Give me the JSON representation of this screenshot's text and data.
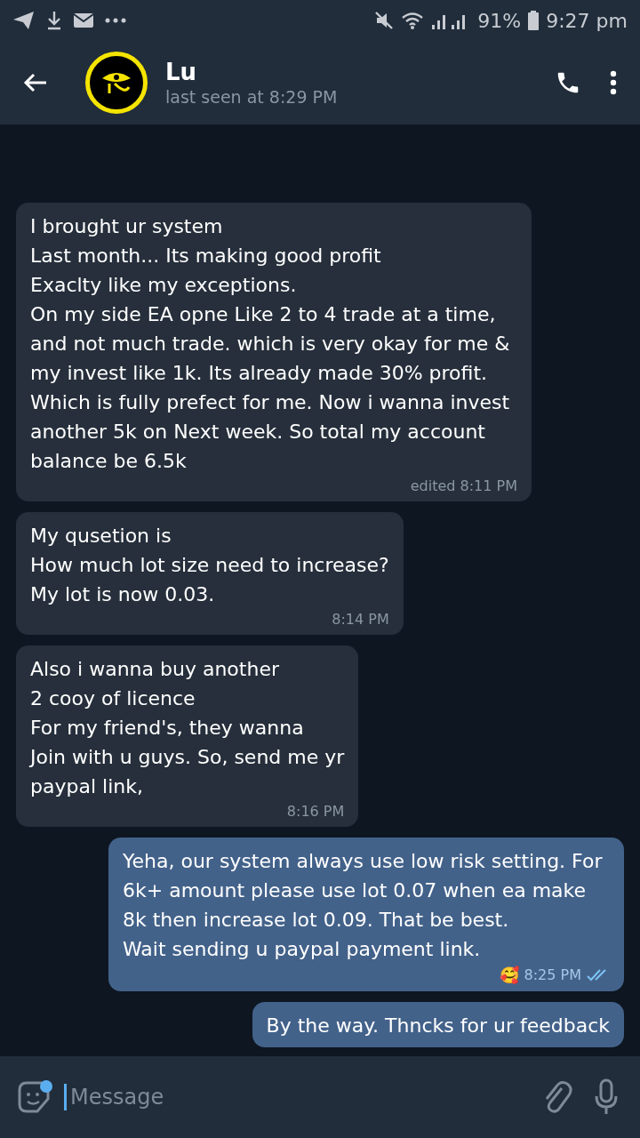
{
  "status_bar": {
    "battery": "91%",
    "time": "9:27 pm"
  },
  "header": {
    "name": "Lu",
    "last_seen": "last seen at 8:29 PM"
  },
  "messages": [
    {
      "outgoing": false,
      "text": "I brought ur system\nLast month...  Its making  good profit\nExaclty like my exceptions.\nOn my side EA opne Like 2 to 4 trade at a time, and not much trade. which is very okay for me & my invest like 1k. Its already made 30% profit. Which is fully prefect for me. Now i wanna invest another  5k on Next week. So total my account  balance be 6.5k",
      "time": "edited 8:11 PM"
    },
    {
      "outgoing": false,
      "text": "My qusetion is\n How much lot size need to increase?\nMy lot is now 0.03.",
      "time": "8:14 PM"
    },
    {
      "outgoing": false,
      "text": "Also i wanna buy another\n2 cooy of licence\nFor my friend's,  they wanna\nJoin with u guys. So, send me yr\npaypal link,",
      "time": "8:16 PM"
    },
    {
      "outgoing": true,
      "text": "Yeha, our system always use low risk setting. For 6k+ amount please use lot 0.07 when ea make 8k then increase lot 0.09. That be best.\nWait sending u paypal payment link.",
      "reaction": "🥰",
      "time": "8:25 PM",
      "read": true
    },
    {
      "outgoing": true,
      "text": "By the way. Thncks for ur feedback"
    }
  ],
  "composer": {
    "placeholder": "Message"
  }
}
